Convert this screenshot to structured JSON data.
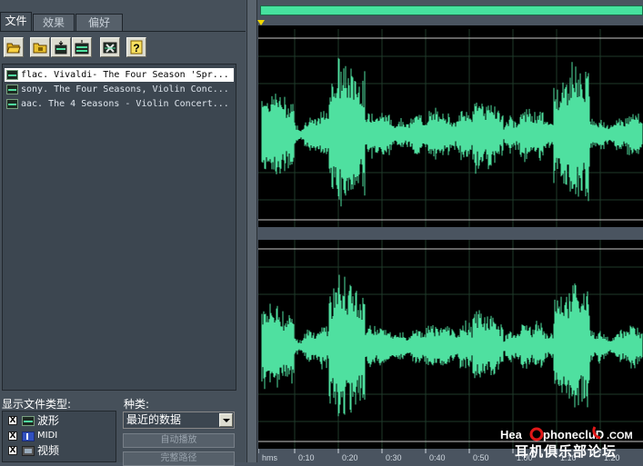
{
  "tabs": [
    {
      "label": "文件",
      "active": true
    },
    {
      "label": "效果",
      "active": false
    },
    {
      "label": "偏好",
      "active": false
    }
  ],
  "toolbar": {
    "icons": [
      "folder-open-icon",
      "folder-closed-icon",
      "insert-icon",
      "insert-multitrack-icon",
      "close-file-icon",
      "help-icon"
    ],
    "help_glyph": "?"
  },
  "files": [
    {
      "name": "flac. Vivaldi- The Four Season 'Spr...",
      "selected": true
    },
    {
      "name": "sony. The Four Seasons, Violin Conc...",
      "selected": false
    },
    {
      "name": "aac. The 4 Seasons - Violin Concert...",
      "selected": false
    }
  ],
  "filetypes": {
    "label": "显示文件类型:",
    "items": [
      {
        "label": "波形",
        "checked": true,
        "icon": "waveform-icon"
      },
      {
        "label": "MIDI",
        "checked": true,
        "icon": "midi-icon"
      },
      {
        "label": "视频",
        "checked": true,
        "icon": "video-icon"
      }
    ],
    "check_mark": "X"
  },
  "kind": {
    "label": "种类:",
    "selected": "最近的数据",
    "buttons": [
      "自动播放",
      "完整路径"
    ]
  },
  "waveform": {
    "color": "#4fe0a0",
    "background": "#000000",
    "overview_color": "#46e29e",
    "time_labels": [
      "hms",
      "0:10",
      "0:20",
      "0:30",
      "0:40",
      "0:50",
      "1:00",
      "1:10",
      "1:20"
    ]
  },
  "watermark": {
    "site": "HeadphoneClub.COM",
    "text": "耳机俱乐部论坛"
  }
}
